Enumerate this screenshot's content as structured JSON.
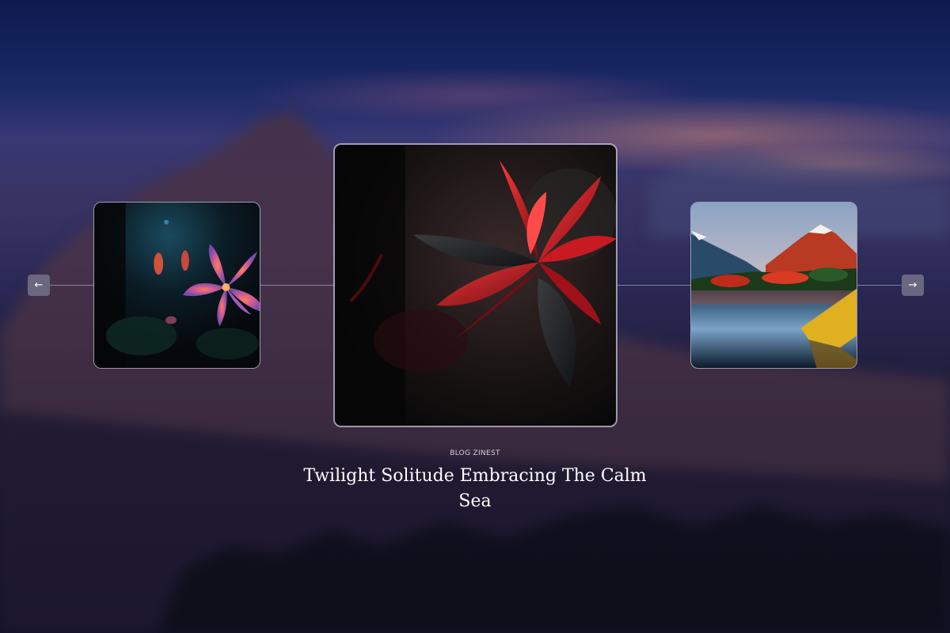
{
  "slider": {
    "prev_icon": "←",
    "next_icon": "→",
    "slides": [
      {
        "position": "previous",
        "image": "night-lily-flower-photo"
      },
      {
        "position": "active",
        "image": "red-leaf-plant-photo"
      },
      {
        "position": "next",
        "image": "mountain-lake-sunset-photo"
      }
    ]
  },
  "caption": {
    "category": "BLOG ZINEST",
    "title": "Twilight Solitude Embracing The Calm Sea"
  },
  "colors": {
    "background": "#1d1c3a",
    "nav_button": "#6a6880",
    "title_text": "#ffffff"
  }
}
